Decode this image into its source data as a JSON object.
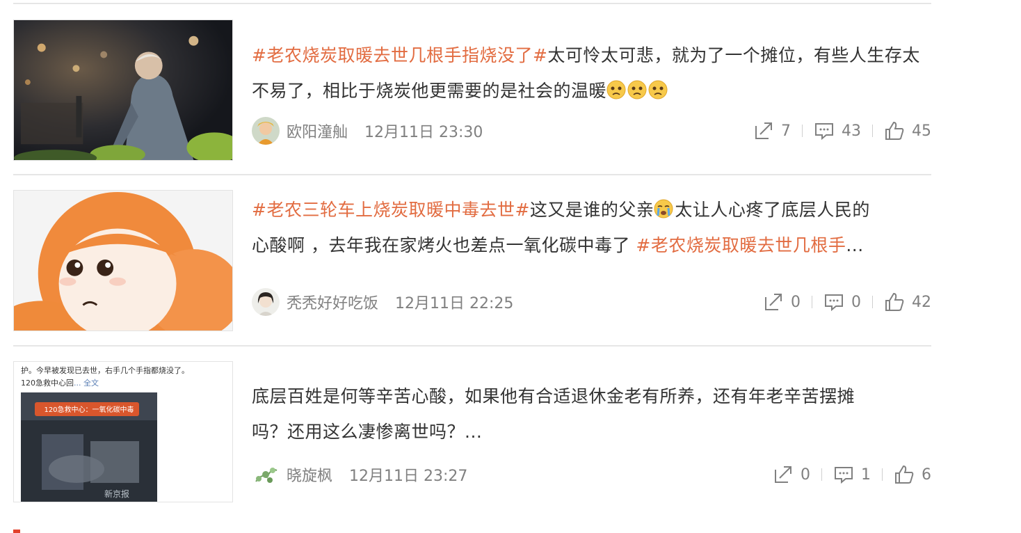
{
  "posts": [
    {
      "segments": [
        {
          "type": "tag",
          "text": "#老农烧炭取暖去世几根手指烧没了#"
        },
        {
          "type": "text",
          "text": "太可怜太可悲，就为了一个摊位，有些人生存太不易了，相比于烧炭他更需要的是社会的温暖"
        }
      ],
      "emojis": [
        "sad-face-emoji",
        "sad-face-emoji",
        "sad-face-emoji"
      ],
      "author": "欧阳潼舢",
      "time": "12月11日 23:30",
      "reposts": "7",
      "comments": "43",
      "likes": "45"
    },
    {
      "line1_tag": "#老农三轮车上烧炭取暖中毒去世#",
      "line1_text": "这又是谁的父亲",
      "line1_text2": "太让人心疼了底层人民的",
      "line2_text": "心酸啊 ，去年我在家烤火也差点一氧化碳中毒了 ",
      "line2_tag": "#老农烧炭取暖去世几根手",
      "line2_ellipsis": "...",
      "emoji": "crying-face-emoji",
      "author": "秃秃好好吃饭",
      "time": "12月11日 22:25",
      "reposts": "0",
      "comments": "0",
      "likes": "42"
    },
    {
      "line1": "底层百姓是何等辛苦心酸，如果他有合适退休金老有所养，还有年老辛苦摆摊",
      "line2": "吗？还用这么凄惨离世吗？...",
      "author": "晓旋枫",
      "time": "12月11日 23:27",
      "reposts": "0",
      "comments": "1",
      "likes": "6",
      "thumb_caption_line1": "护。今早被发现已去世，右手几个手指都烧没了。",
      "thumb_caption_line2": "120急救中心回",
      "thumb_caption_more": "... 全文",
      "thumb_banner": "120急救中心：一氧化碳中毒",
      "thumb_watermark": "新京报"
    }
  ],
  "colors": {
    "accent": "#e26c41",
    "muted": "#808080",
    "text": "#333333",
    "divider": "#e6e6e6"
  }
}
